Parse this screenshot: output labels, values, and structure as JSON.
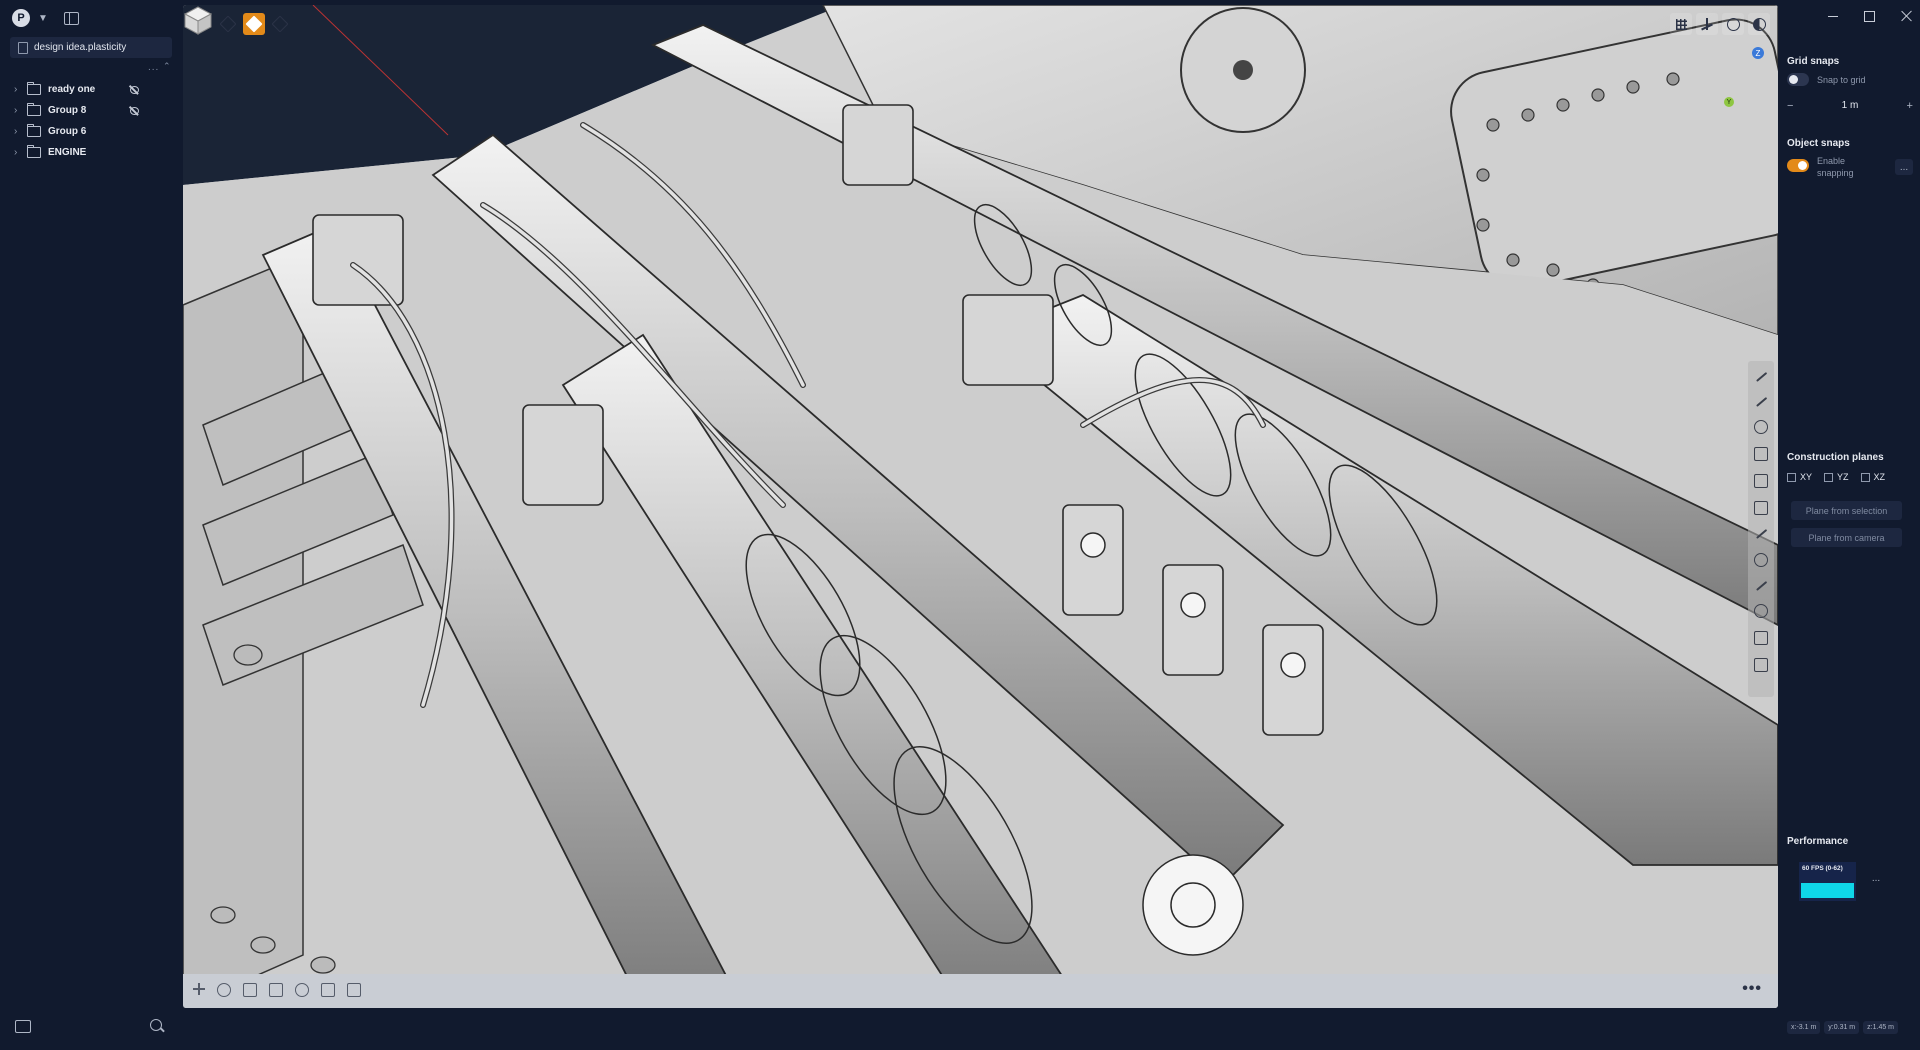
{
  "app": {
    "logo_letter": "P",
    "file_name": "design idea.plasticity"
  },
  "sidebar": {
    "menu_dots": "...",
    "items": [
      {
        "label": "ready one",
        "hidden": true
      },
      {
        "label": "Group 8",
        "hidden": true
      },
      {
        "label": "Group 6",
        "hidden": false
      },
      {
        "label": "ENGINE",
        "hidden": false
      }
    ]
  },
  "viewport": {
    "toolbar_modes": [
      "vertex-mode-icon",
      "edge-mode-icon",
      "face-mode-icon",
      "solid-mode-icon"
    ],
    "active_mode": 2,
    "nav_badge": "Z",
    "nav_axis": "Y",
    "bottom_more": "•••"
  },
  "right_panel": {
    "grid_snaps": {
      "title": "Grid snaps",
      "snap_label": "Snap to grid",
      "snap_on": false,
      "step_value": "1 m",
      "minus": "−",
      "plus": "+"
    },
    "object_snaps": {
      "title": "Object snaps",
      "enable_label_1": "Enable",
      "enable_label_2": "snapping",
      "enabled": true,
      "more": "..."
    },
    "construction_planes": {
      "title": "Construction planes",
      "planes": [
        "XY",
        "YZ",
        "XZ"
      ],
      "btn_selection": "Plane from selection",
      "btn_camera": "Plane from camera"
    },
    "performance": {
      "title": "Performance",
      "fps_label": "60 FPS (0-62)",
      "more": "..."
    },
    "coords": {
      "x": "x:-3.1 m",
      "y": "y:0.31 m",
      "z": "z:1.45 m"
    }
  },
  "colors": {
    "accent": "#e38a19",
    "panel_bg": "#111a2e",
    "viewport_bg": "#cfcfcf",
    "fps_bar": "#0fd6e8"
  }
}
